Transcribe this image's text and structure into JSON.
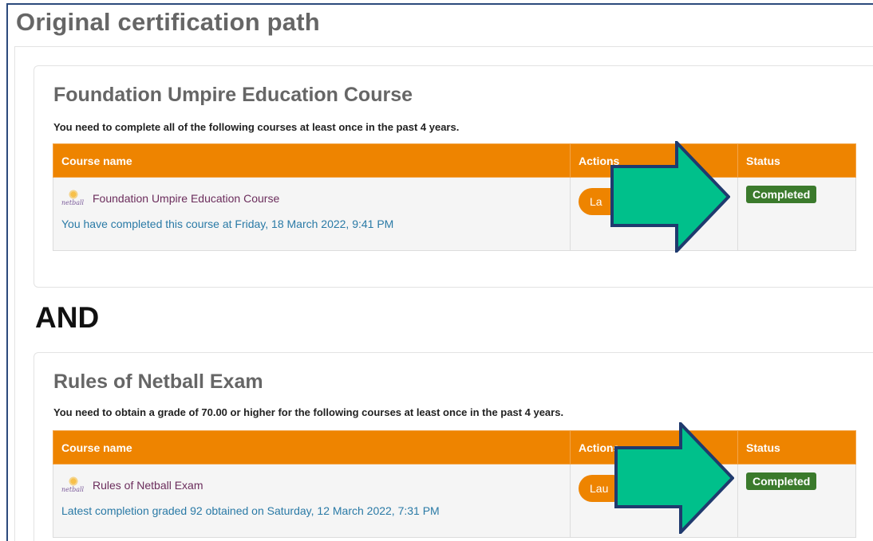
{
  "page": {
    "title": "Original certification path",
    "connector": "AND"
  },
  "table_headers": {
    "course_name": "Course name",
    "actions": "Actions",
    "status": "Status"
  },
  "cards": [
    {
      "title": "Foundation Umpire Education Course",
      "description": "You need to complete all of the following courses at least once in the past 4 years.",
      "course": {
        "name": "Foundation Umpire Education Course",
        "logo_text": "netball",
        "detail": "You have completed this course at Friday, 18 March 2022, 9:41 PM",
        "action_label": "La",
        "status": "Completed"
      }
    },
    {
      "title": "Rules of Netball Exam",
      "description": "You need to obtain a grade of 70.00 or higher for the following courses at least once in the past 4 years.",
      "course": {
        "name": "Rules of Netball Exam",
        "logo_text": "netball",
        "detail": "Latest completion graded 92 obtained on Saturday, 12 March 2022, 7:31 PM",
        "action_label": "Lau",
        "status": "Completed"
      }
    }
  ],
  "colors": {
    "header_orange": "#ee8400",
    "status_green": "#3b7a2c",
    "arrow_fill": "#00c08b",
    "arrow_stroke": "#1f3a6e",
    "frame_border": "#2c4a7c"
  },
  "icons": {
    "course_logo": "netball-logo-icon",
    "annotation": "arrow-right-icon"
  }
}
